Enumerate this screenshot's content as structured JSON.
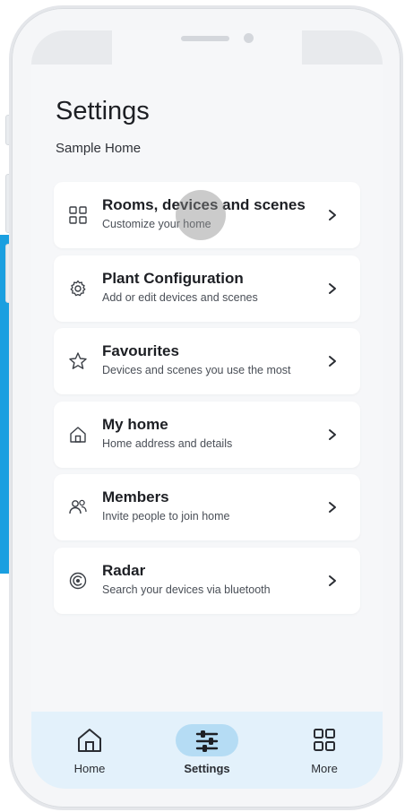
{
  "page": {
    "title": "Settings",
    "subtitle": "Sample Home"
  },
  "items": [
    {
      "title": "Rooms, devices and scenes",
      "desc": "Customize your home",
      "icon": "grid-icon"
    },
    {
      "title": "Plant Configuration",
      "desc": "Add or edit devices and scenes",
      "icon": "gear-icon"
    },
    {
      "title": "Favourites",
      "desc": "Devices and scenes you use the most",
      "icon": "star-icon"
    },
    {
      "title": "My home",
      "desc": "Home address and details",
      "icon": "home-icon"
    },
    {
      "title": "Members",
      "desc": "Invite people to join home",
      "icon": "users-icon"
    },
    {
      "title": "Radar",
      "desc": "Search your devices via bluetooth",
      "icon": "radar-icon"
    }
  ],
  "tabs": [
    {
      "label": "Home",
      "icon": "home-icon",
      "active": false
    },
    {
      "label": "Settings",
      "icon": "sliders-icon",
      "active": true
    },
    {
      "label": "More",
      "icon": "grid-icon",
      "active": false
    }
  ],
  "colors": {
    "accent": "#1a9fe0",
    "tab_bg": "#e3f1fb",
    "active_pill": "#b5dcf4"
  }
}
